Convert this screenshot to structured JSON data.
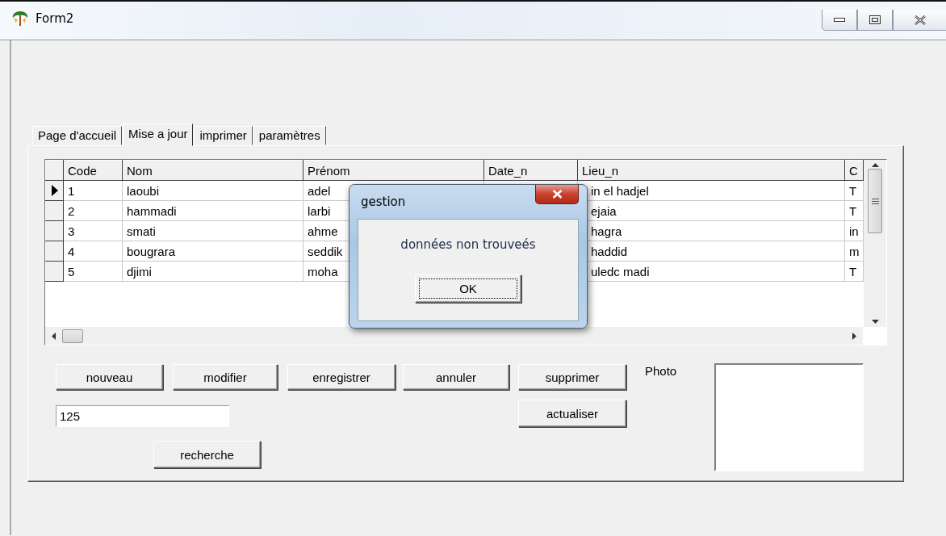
{
  "window": {
    "title": "Form2"
  },
  "tabs": [
    {
      "label": "Page d'accueil",
      "selected": false
    },
    {
      "label": "Mise a jour",
      "selected": true
    },
    {
      "label": "imprimer",
      "selected": false
    },
    {
      "label": "paramètres",
      "selected": false
    }
  ],
  "grid": {
    "columns": [
      "Code",
      "Nom",
      "Prénom",
      "Date_n",
      "Lieu_n",
      "C"
    ],
    "rows": [
      {
        "selected": true,
        "code": "1",
        "nom": "laoubi",
        "prenom": "adel",
        "lieu": "in el hadjel",
        "column_6": "T"
      },
      {
        "selected": false,
        "code": "2",
        "nom": "hammadi",
        "prenom": "larbi",
        "lieu": "ejaia",
        "column_6": "T"
      },
      {
        "selected": false,
        "code": "3",
        "nom": "smati",
        "prenom": "ahme",
        "lieu": "hagra",
        "column_6": "in"
      },
      {
        "selected": false,
        "code": "4",
        "nom": "bougrara",
        "prenom": "seddik",
        "lieu": "haddid",
        "column_6": "m"
      },
      {
        "selected": false,
        "code": "5",
        "nom": "djimi",
        "prenom": "moha",
        "lieu": "uledc madi",
        "column_6": "T"
      }
    ]
  },
  "buttons": [
    "nouveau",
    "modifier",
    "enregistrer",
    "annuler",
    "supprimer"
  ],
  "refresh_button": "actualiser",
  "search_field": {
    "value": "125"
  },
  "search_button": "recherche",
  "photo": {
    "label": "Photo"
  },
  "dialog": {
    "title": "gestion",
    "message": "données non trouveés",
    "button": "OK"
  }
}
